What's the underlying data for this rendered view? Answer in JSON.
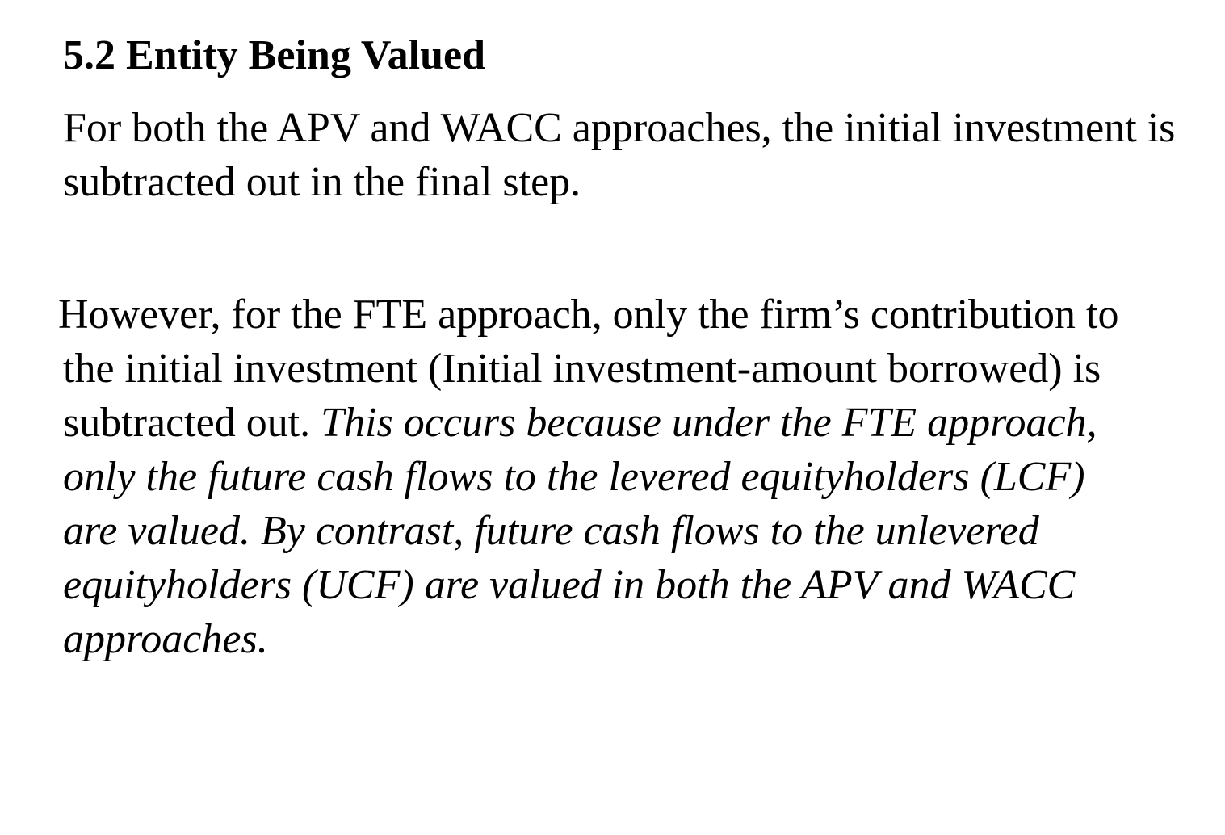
{
  "heading": "5.2 Entity Being Valued",
  "paragraph1": "For both the APV and WACC approaches, the initial investment is subtracted out in the final step.",
  "paragraph2": {
    "line1": "However, for the FTE approach, only the firm’s contribution to",
    "line2": "the initial investment (Initial investment-amount borrowed) is",
    "line3_plain": "subtracted out. ",
    "line3_italic": "This occurs because under the FTE approach,",
    "line4": "only the future cash flows to the levered equityholders (LCF)",
    "line5": "are valued. By contrast, future cash flows to the unlevered",
    "line6": "equityholders (UCF) are valued in both the APV and WACC",
    "line7": "approaches."
  }
}
